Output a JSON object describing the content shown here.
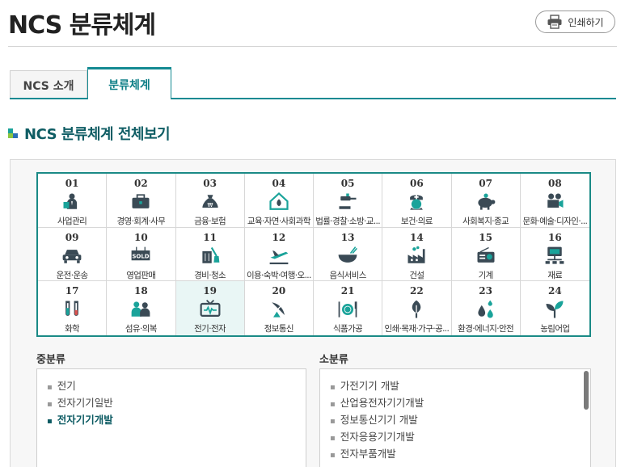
{
  "page": {
    "title": "NCS 분류체계"
  },
  "print_button": {
    "label": "인쇄하기"
  },
  "tabs": [
    {
      "label": "NCS 소개",
      "active": false
    },
    {
      "label": "분류체계",
      "active": true
    }
  ],
  "section": {
    "title": "NCS 분류체계 전체보기"
  },
  "categories": [
    {
      "num": "01",
      "label": "사업관리",
      "icon": "business-manager-icon"
    },
    {
      "num": "02",
      "label": "경영·회계·사무",
      "icon": "briefcase-icon"
    },
    {
      "num": "03",
      "label": "금융·보험",
      "icon": "money-bag-icon"
    },
    {
      "num": "04",
      "label": "교육·자연·사회과학",
      "icon": "house-leaf-icon"
    },
    {
      "num": "05",
      "label": "법률·경찰·소방·교...",
      "icon": "gavel-icon"
    },
    {
      "num": "06",
      "label": "보건·의료",
      "icon": "nurse-icon"
    },
    {
      "num": "07",
      "label": "사회복지·종교",
      "icon": "piggy-bank-icon"
    },
    {
      "num": "08",
      "label": "문화·예술·디자인·...",
      "icon": "film-camera-icon"
    },
    {
      "num": "09",
      "label": "운전·운송",
      "icon": "car-icon"
    },
    {
      "num": "10",
      "label": "영업판매",
      "icon": "sold-sign-icon"
    },
    {
      "num": "11",
      "label": "경비·청소",
      "icon": "broom-trash-icon"
    },
    {
      "num": "12",
      "label": "이용·숙박·여행·오...",
      "icon": "airplane-icon"
    },
    {
      "num": "13",
      "label": "음식서비스",
      "icon": "bowl-icon"
    },
    {
      "num": "14",
      "label": "건설",
      "icon": "factory-icon"
    },
    {
      "num": "15",
      "label": "기계",
      "icon": "radio-icon"
    },
    {
      "num": "16",
      "label": "재료",
      "icon": "network-icon"
    },
    {
      "num": "17",
      "label": "화학",
      "icon": "test-tube-icon"
    },
    {
      "num": "18",
      "label": "섬유·의복",
      "icon": "people-icon"
    },
    {
      "num": "19",
      "label": "전기·전자",
      "icon": "tv-icon"
    },
    {
      "num": "20",
      "label": "정보통신",
      "icon": "satellite-dish-icon"
    },
    {
      "num": "21",
      "label": "식품가공",
      "icon": "plate-cutlery-icon"
    },
    {
      "num": "22",
      "label": "인쇄·목재·가구·공...",
      "icon": "tree-icon"
    },
    {
      "num": "23",
      "label": "환경·에너지·안전",
      "icon": "water-drops-icon"
    },
    {
      "num": "24",
      "label": "농림어업",
      "icon": "sprout-icon"
    }
  ],
  "selected_category": "19",
  "mid_class": {
    "title": "중분류",
    "items": [
      {
        "label": "전기",
        "active": false
      },
      {
        "label": "전자기기일반",
        "active": false
      },
      {
        "label": "전자기기개발",
        "active": true
      }
    ]
  },
  "small_class": {
    "title": "소분류",
    "items": [
      {
        "label": "가전기기 개발"
      },
      {
        "label": "산업용전자기기개발"
      },
      {
        "label": "정보통신기기 개발"
      },
      {
        "label": "전자응용기기개발"
      },
      {
        "label": "전자부품개발"
      }
    ]
  },
  "colors": {
    "accent": "#148a92",
    "icon_dark": "#3a4a55",
    "icon_teal": "#1aa39a"
  }
}
